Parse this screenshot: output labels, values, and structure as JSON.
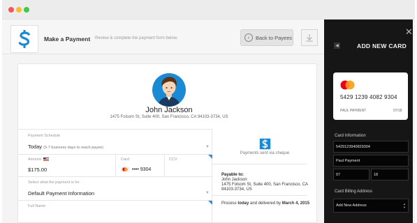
{
  "header": {
    "title": "Make a Payment",
    "subtitle": "Review & complete the payment form below.",
    "back_label": "Back to Payees"
  },
  "payee": {
    "name": "John Jackson",
    "address": "1475 Folsom St, Suite 400, San Francisco, CA 94103-3734, US"
  },
  "form": {
    "schedule_label": "Payment Schedule",
    "schedule_value": "Today",
    "schedule_note": "(5-7 business days to reach payee)",
    "amount_label": "Amount",
    "amount_value": "$175.00",
    "card_label": "Card",
    "card_value": "•••• 9304",
    "ccv_label": "CCV",
    "purpose_label": "Select what the payment is for",
    "purpose_value": "Default Payment Information",
    "fullname_label": "Full Name"
  },
  "summary": {
    "cheque_label": "Payments sent via cheque",
    "payable_title": "Payable to:",
    "payable_name": "John Jackson",
    "payable_addr1": "1475 Folsom St, Suite 400, San Francisco, CA",
    "payable_addr2": "94103-3734, US",
    "process_pre": "Process ",
    "process_today": "today",
    "process_mid": " and delivered by ",
    "process_date": "March 4, 2015"
  },
  "panel": {
    "title": "ADD NEW CARD",
    "card_number": "5429 1239 4082 9304",
    "card_name": "PAUL PAYMENT",
    "card_exp": "07/18",
    "card_info_label": "Card Information",
    "field_number": "5429123940829304",
    "field_name": "Paul Payment",
    "field_month": "07",
    "field_year": "18",
    "billing_label": "Card Billing Address",
    "billing_value": "Add New Address"
  },
  "colors": {
    "accent": "#1a8ad4",
    "panel_bg": "#161616",
    "mastercard_red": "#eb001b",
    "mastercard_orange": "#f79e1b"
  },
  "icons": [
    "dollar-icon",
    "arrow-left-icon",
    "download-icon",
    "close-icon",
    "back-icon",
    "us-flag-icon",
    "mastercard-icon",
    "cheque-dollar-icon",
    "caret-down-icon"
  ]
}
